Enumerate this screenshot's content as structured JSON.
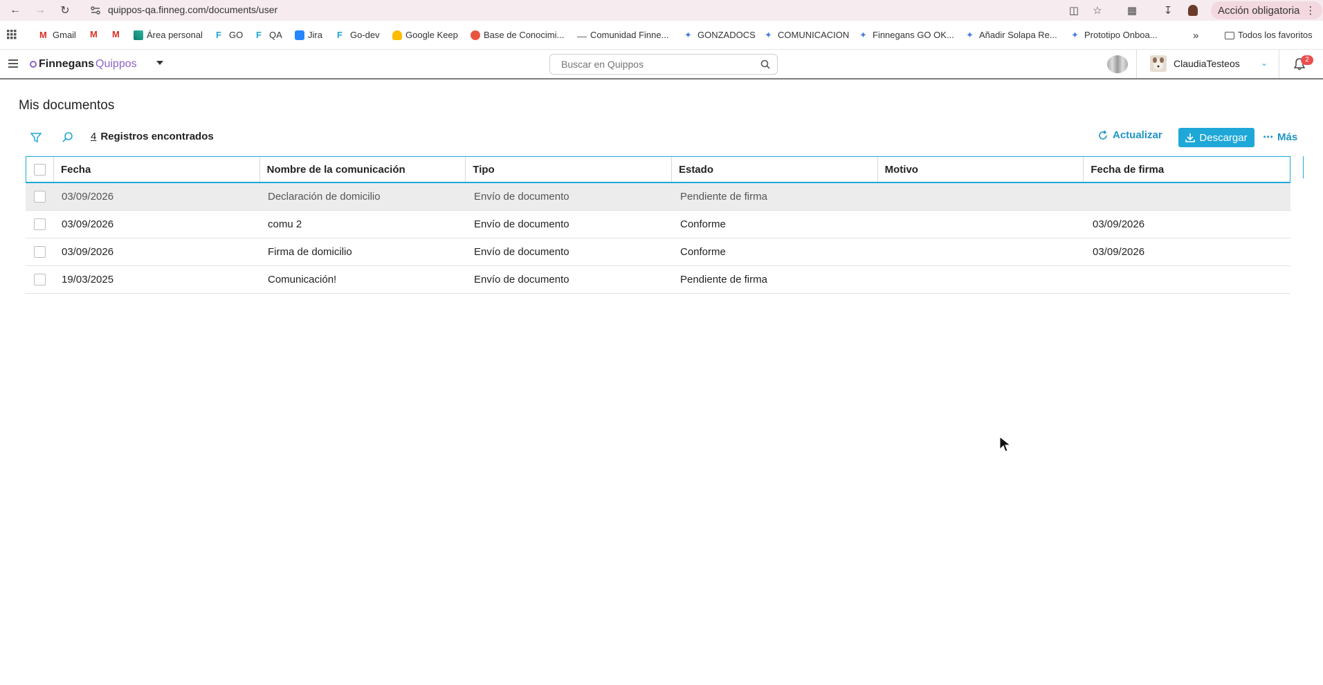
{
  "browser": {
    "url": "quippos-qa.finneg.com/documents/user",
    "action_label": "Acción obligatoria",
    "bookmarks": [
      {
        "label": "Gmail",
        "icon": "gmail-icon"
      },
      {
        "label": "",
        "icon": "gmail-icon"
      },
      {
        "label": "",
        "icon": "gmail-icon"
      },
      {
        "label": "Área personal",
        "icon": "chart-icon"
      },
      {
        "label": "GO",
        "icon": "finnegans-icon"
      },
      {
        "label": "QA",
        "icon": "finnegans-icon"
      },
      {
        "label": "Jira",
        "icon": "jira-icon"
      },
      {
        "label": "Go-dev",
        "icon": "finnegans-icon"
      },
      {
        "label": "Google Keep",
        "icon": "keep-icon"
      },
      {
        "label": "Base de Conocimi...",
        "icon": "base-icon"
      },
      {
        "label": "Comunidad Finne...",
        "icon": "dash-icon"
      },
      {
        "label": "GONZADOCS",
        "icon": "sparkle-icon"
      },
      {
        "label": "COMUNICACION",
        "icon": "sparkle-icon"
      },
      {
        "label": "Finnegans GO OK...",
        "icon": "sparkle-icon"
      },
      {
        "label": "Añadir Solapa Re...",
        "icon": "sparkle-icon"
      },
      {
        "label": "Prototipo Onboa...",
        "icon": "sparkle-icon"
      }
    ],
    "all_bookmarks": "Todos los favoritos"
  },
  "header": {
    "logo_primary": "Finnegans",
    "logo_secondary": "Quippos",
    "search_placeholder": "Buscar en Quippos",
    "username": "ClaudiaTesteos",
    "notification_count": "2"
  },
  "page": {
    "title": "Mis documentos",
    "record_count": "4",
    "record_label": "Registros encontrados",
    "refresh_label": "Actualizar",
    "download_label": "Descargar",
    "more_label": "Más"
  },
  "table": {
    "columns": [
      "Fecha",
      "Nombre de la comunicación",
      "Tipo",
      "Estado",
      "Motivo",
      "Fecha de firma"
    ],
    "rows": [
      {
        "fecha": "03/09/2026",
        "nombre": "Declaración de domicilio",
        "tipo": "Envío de documento",
        "estado": "Pendiente de firma",
        "motivo": "",
        "fecha_firma": "",
        "selected": true
      },
      {
        "fecha": "03/09/2026",
        "nombre": "comu 2",
        "tipo": "Envío de documento",
        "estado": "Conforme",
        "motivo": "",
        "fecha_firma": "03/09/2026",
        "selected": false
      },
      {
        "fecha": "03/09/2026",
        "nombre": "Firma de domicilio",
        "tipo": "Envío de documento",
        "estado": "Conforme",
        "motivo": "",
        "fecha_firma": "03/09/2026",
        "selected": false
      },
      {
        "fecha": "19/03/2025",
        "nombre": "Comunicación!",
        "tipo": "Envío de documento",
        "estado": "Pendiente de firma",
        "motivo": "",
        "fecha_firma": "",
        "selected": false
      }
    ]
  },
  "colors": {
    "accent": "#1fa7d8",
    "brand_purple": "#8a63c9",
    "selected_row": "#ececec",
    "badge": "#e94f4f"
  }
}
